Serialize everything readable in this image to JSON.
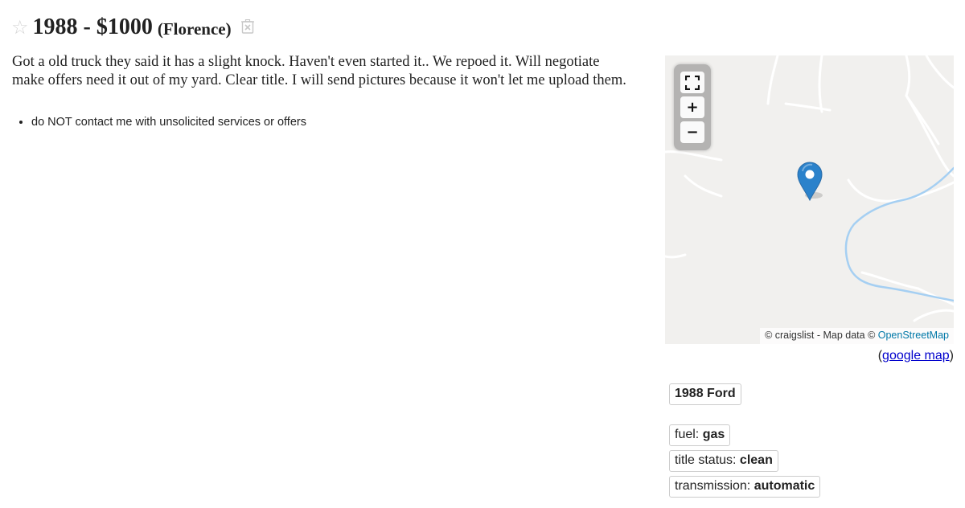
{
  "posting": {
    "title": "1988 - $1000",
    "location": "(Florence)",
    "body_line1": "Got a old truck they said it has a slight knock. Haven't even started it.. We repoed it. Will negotiate",
    "body_line2": "make offers need it out of my yard. Clear title. I will send pictures because it won't let me upload them.",
    "notices": [
      "do NOT contact me with unsolicited services or offers"
    ]
  },
  "map": {
    "fullscreen_icon": "fullscreen-icon",
    "zoom_in_label": "+",
    "zoom_out_label": "−",
    "attribution_prefix": "© craigslist - Map data © ",
    "attribution_link": "OpenStreetMap",
    "google_open": "(",
    "google_link": "google map",
    "google_close": ")"
  },
  "attributes": {
    "vehicle": "1988 Ford",
    "items": [
      {
        "label": "fuel: ",
        "value": "gas"
      },
      {
        "label": "title status: ",
        "value": "clean"
      },
      {
        "label": "transmission: ",
        "value": "automatic"
      }
    ]
  },
  "colors": {
    "link": "#0000cc",
    "osm_link": "#0078a8",
    "marker": "#2b82cb",
    "map_bg": "#f1f0ee",
    "water": "#a5cff2"
  }
}
